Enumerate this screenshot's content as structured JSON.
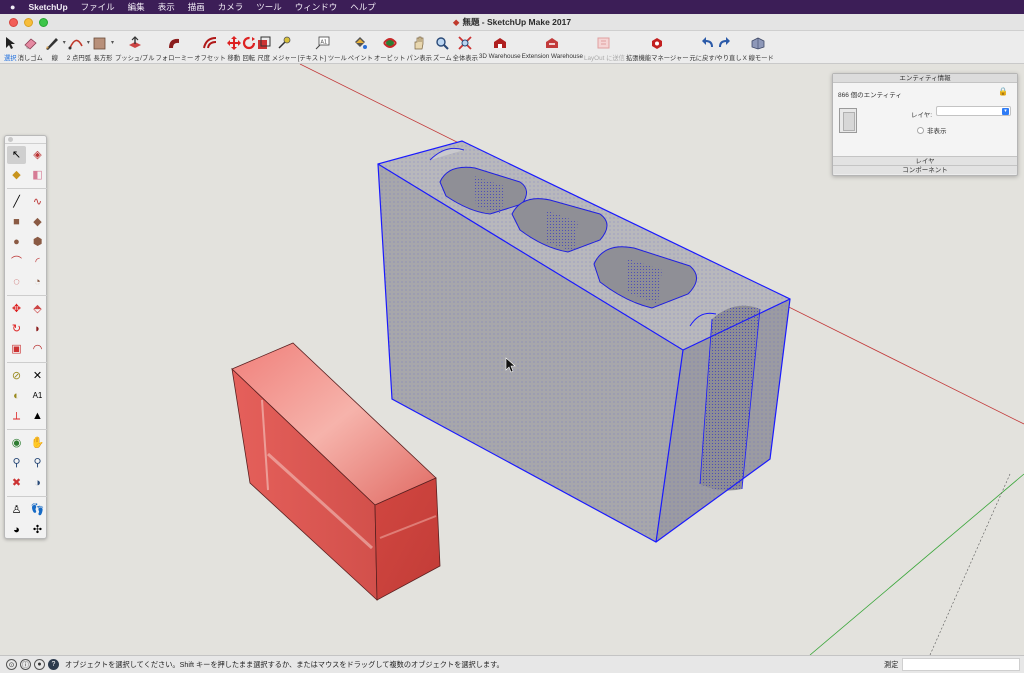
{
  "menubar": {
    "apple": "",
    "app": "SketchUp",
    "items": [
      "ファイル",
      "編集",
      "表示",
      "描画",
      "カメラ",
      "ツール",
      "ウィンドウ",
      "ヘルプ"
    ]
  },
  "window": {
    "title": "無題 - SketchUp Make 2017"
  },
  "toolbar": {
    "items": [
      {
        "label": "選択",
        "icon": "select-arrow-icon",
        "active": true
      },
      {
        "label": "消しゴム",
        "icon": "eraser-icon"
      },
      {
        "label": "線",
        "icon": "pencil-icon"
      },
      {
        "label": "2 点円弧",
        "icon": "arc-icon"
      },
      {
        "label": "長方形",
        "icon": "rectangle-icon"
      },
      {
        "label": "プッシュ/プル",
        "icon": "push-pull-icon"
      },
      {
        "label": "フォローミー",
        "icon": "follow-me-icon"
      },
      {
        "label": "オフセット",
        "icon": "offset-icon"
      },
      {
        "label": "移動",
        "icon": "move-icon"
      },
      {
        "label": "回転",
        "icon": "rotate-icon"
      },
      {
        "label": "尺度",
        "icon": "scale-icon"
      },
      {
        "label": "メジャー",
        "icon": "tape-measure-icon"
      },
      {
        "label": "[テキスト] ツール",
        "icon": "text-tool-icon"
      },
      {
        "label": "ペイント",
        "icon": "paint-bucket-icon"
      },
      {
        "label": "オービット",
        "icon": "orbit-icon"
      },
      {
        "label": "パン表示",
        "icon": "pan-hand-icon"
      },
      {
        "label": "ズーム",
        "icon": "zoom-icon"
      },
      {
        "label": "全体表示",
        "icon": "zoom-extents-icon"
      },
      {
        "label": "3D Warehouse",
        "icon": "warehouse-icon"
      },
      {
        "label": "Extension Warehouse",
        "icon": "extension-warehouse-icon"
      },
      {
        "label": "LayOut に送信",
        "icon": "layout-icon",
        "dim": true
      },
      {
        "label": "拡張機能マネージャー",
        "icon": "extension-manager-icon"
      },
      {
        "label": "元に戻す/やり直し",
        "icon": "undo-redo-icon"
      },
      {
        "label": "X 線モード",
        "icon": "xray-icon"
      }
    ]
  },
  "entity_info": {
    "title": "エンティティ情報",
    "count": "866 個のエンティティ",
    "layer_label": "レイヤ:",
    "layer_value": "",
    "hidden_label": "非表示",
    "sections": [
      "レイヤ",
      "コンポーネント"
    ]
  },
  "statusbar": {
    "message": "オブジェクトを選択してください。Shift キーを押したまま選択するか、またはマウスをドラッグして複数のオブジェクトを選択します。",
    "measure_label": "測定",
    "measure_value": ""
  },
  "colors": {
    "menubar_bg": "#3c1e57",
    "viewport_bg": "#e3e2dd",
    "selection_blue": "#1a1aff",
    "brick_red": "#e2635f",
    "concrete_gray": "#a9a9ab",
    "axis_red": "#c23a3a",
    "axis_green": "#3aa63a"
  }
}
